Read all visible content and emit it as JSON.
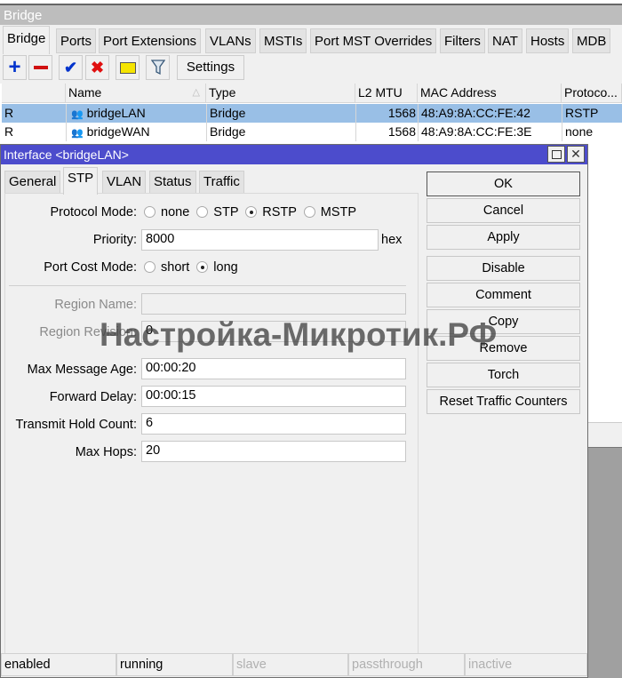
{
  "window_title": "Bridge",
  "tabs": [
    "Bridge",
    "Ports",
    "Port Extensions",
    "VLANs",
    "MSTIs",
    "Port MST Overrides",
    "Filters",
    "NAT",
    "Hosts",
    "MDB"
  ],
  "toolbar": {
    "add": "add-icon",
    "remove": "remove-icon",
    "enable": "check-icon",
    "disable": "cross-icon",
    "comment": "note-icon",
    "filter": "filter-icon",
    "settings_label": "Settings"
  },
  "table": {
    "columns": [
      "",
      "Name",
      "Type",
      "L2 MTU",
      "MAC Address",
      "Protoco..."
    ],
    "rows": [
      {
        "flag": "R",
        "name": "bridgeLAN",
        "type": "Bridge",
        "l2mtu": "1568",
        "mac": "48:A9:8A:CC:FE:42",
        "protocol": "RSTP",
        "selected": true
      },
      {
        "flag": "R",
        "name": "bridgeWAN",
        "type": "Bridge",
        "l2mtu": "1568",
        "mac": "48:A9:8A:CC:FE:3E",
        "protocol": "none",
        "selected": false
      }
    ]
  },
  "dialog": {
    "title": "Interface <bridgeLAN>",
    "tabs": [
      "General",
      "STP",
      "VLAN",
      "Status",
      "Traffic"
    ],
    "active_tab": "STP",
    "form": {
      "protocol_mode_label": "Protocol Mode:",
      "protocol_modes": [
        "none",
        "STP",
        "RSTP",
        "MSTP"
      ],
      "protocol_mode_selected": "RSTP",
      "priority_label": "Priority:",
      "priority": "8000",
      "priority_unit": "hex",
      "port_cost_mode_label": "Port Cost Mode:",
      "port_cost_modes": [
        "short",
        "long"
      ],
      "port_cost_mode_selected": "long",
      "region_name_label": "Region Name:",
      "region_name": "",
      "region_revision_label": "Region Revision:",
      "region_revision": "0",
      "max_message_age_label": "Max Message Age:",
      "max_message_age": "00:00:20",
      "forward_delay_label": "Forward Delay:",
      "forward_delay": "00:00:15",
      "transmit_hold_count_label": "Transmit Hold Count:",
      "transmit_hold_count": "6",
      "max_hops_label": "Max Hops:",
      "max_hops": "20"
    },
    "buttons": [
      "OK",
      "Cancel",
      "Apply",
      "Disable",
      "Comment",
      "Copy",
      "Remove",
      "Torch",
      "Reset Traffic Counters"
    ],
    "status": [
      "enabled",
      "running",
      "slave",
      "passthrough",
      "inactive"
    ]
  },
  "watermark": "Настройка-Микротик.РФ",
  "colors": {
    "title_bar": "#4c4ccc",
    "selected_row": "#99bfe6"
  }
}
